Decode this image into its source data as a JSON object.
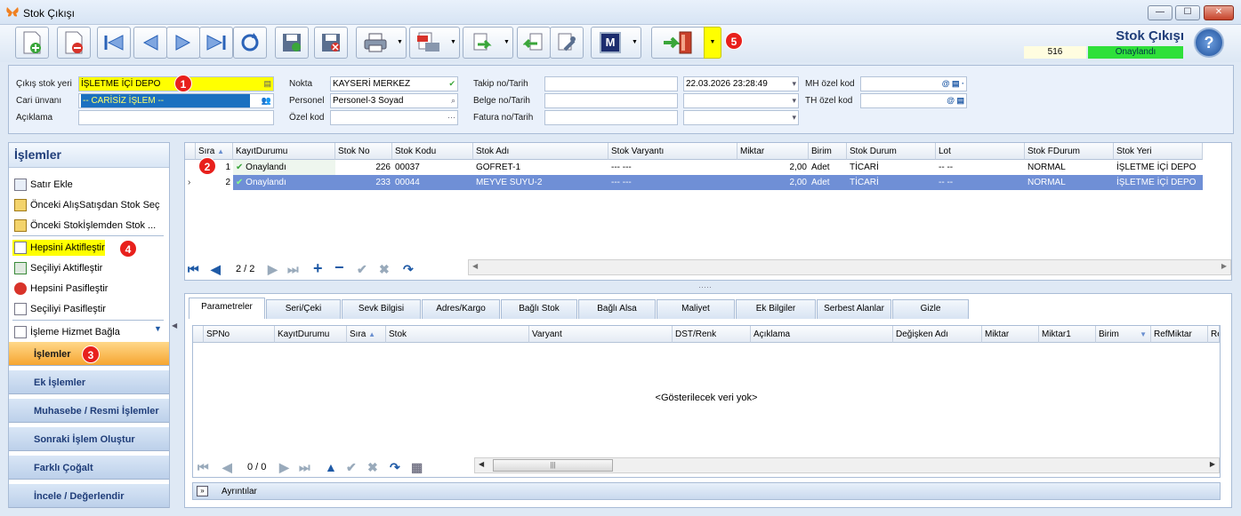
{
  "window": {
    "title": "Stok Çıkışı",
    "min": "—",
    "max": "☐",
    "close": "✕"
  },
  "toolbar": {
    "doc_title": "Stok Çıkışı",
    "doc_number": "516",
    "doc_status": "Onaylandı",
    "help": "?",
    "m_label": "M"
  },
  "badges": {
    "b1": "1",
    "b2": "2",
    "b3": "3",
    "b4": "4",
    "b5": "5"
  },
  "header": {
    "cikis_stok_yeri_label": "Çıkış stok yeri",
    "cikis_stok_yeri_value": "İŞLETME İÇİ DEPO",
    "cari_unvani_label": "Cari ünvanı",
    "cari_unvani_value": "-- CARİSİZ İŞLEM --",
    "aciklama_label": "Açıklama",
    "aciklama_value": "",
    "nokta_label": "Nokta",
    "nokta_value": "KAYSERİ MERKEZ",
    "personel_label": "Personel",
    "personel_value": "Personel-3 Soyad",
    "ozel_kod_label": "Özel kod",
    "ozel_kod_value": "",
    "takip_label": "Takip no/Tarih",
    "takip_value": "",
    "takip_tarih": "22.03.2026 23:28:49",
    "belge_label": "Belge no/Tarih",
    "belge_value": "",
    "belge_tarih": "",
    "fatura_label": "Fatura no/Tarih",
    "fatura_value": "",
    "fatura_tarih": "",
    "mh_label": "MH özel kod",
    "mh_value": "",
    "th_label": "TH özel kod",
    "th_value": ""
  },
  "left_panel": {
    "title": "İşlemler",
    "items": [
      "Satır Ekle",
      "Önceki AlışSatışdan Stok Seç",
      "Önceki Stokİşlemden Stok ...",
      "Hepsini Aktifleştir",
      "Seçiliyi Aktifleştir",
      "Hepsini Pasifleştir",
      "Seçiliyi Pasifleştir",
      "İşleme Hizmet Bağla"
    ],
    "groups": [
      "İşlemler",
      "Ek İşlemler",
      "Muhasebe / Resmi İşlemler",
      "Sonraki İşlem Oluştur",
      "Farklı Çoğalt",
      "İncele / Değerlendir"
    ]
  },
  "grid1": {
    "columns": [
      "Sıra",
      "KayıtDurumu",
      "Stok No",
      "Stok Kodu",
      "Stok Adı",
      "Stok Varyantı",
      "Miktar",
      "Birim",
      "Stok Durum",
      "Lot",
      "Stok FDurum",
      "Stok Yeri"
    ],
    "rows": [
      {
        "sira": "1",
        "durum": "Onaylandı",
        "stok_no": "226",
        "stok_kodu": "00037",
        "stok_adi": "GOFRET-1",
        "varyant": "--- ---",
        "miktar": "2,00",
        "birim": "Adet",
        "stok_durum": "TİCARİ",
        "lot": "-- --",
        "fdurum": "NORMAL",
        "yer": "İŞLETME İÇİ DEPO"
      },
      {
        "sira": "2",
        "durum": "Onaylandı",
        "stok_no": "233",
        "stok_kodu": "00044",
        "stok_adi": "MEYVE SUYU-2",
        "varyant": "--- ---",
        "miktar": "2,00",
        "birim": "Adet",
        "stok_durum": "TİCARİ",
        "lot": "-- --",
        "fdurum": "NORMAL",
        "yer": "İŞLETME İÇİ DEPO"
      }
    ],
    "pager": "2 / 2"
  },
  "tabs": [
    "Parametreler",
    "Seri/Çeki",
    "Sevk Bilgisi",
    "Adres/Kargo",
    "Bağlı Stok",
    "Bağlı Alsa",
    "Maliyet",
    "Ek Bilgiler",
    "Serbest Alanlar",
    "Gizle"
  ],
  "grid2": {
    "columns": [
      "SPNo",
      "KayıtDurumu",
      "Sıra",
      "Stok",
      "Varyant",
      "DST/Renk",
      "Açıklama",
      "Değişken Adı",
      "Miktar",
      "Miktar1",
      "Birim",
      "RefMiktar",
      "Re"
    ],
    "empty_text": "<Gösterilecek veri yok>",
    "pager": "0 / 0",
    "scroll_grip": "|||"
  },
  "details_label": "Ayrıntılar",
  "colors": {
    "accent": "#1f3d79",
    "status_green": "#2fe03a",
    "highlight_yellow": "#ffff00",
    "badge_red": "#e8201c",
    "selected_row": "#6f8fd6"
  }
}
